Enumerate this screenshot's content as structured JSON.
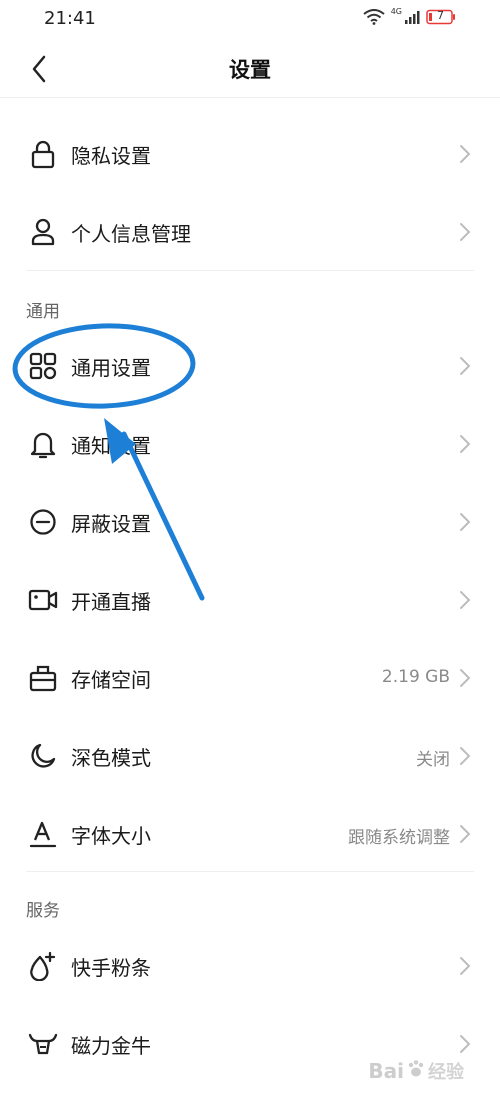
{
  "status": {
    "time": "21:41",
    "network": "4G",
    "battery": "7"
  },
  "nav": {
    "title": "设置"
  },
  "rows_top": [
    {
      "label": "隐私设置",
      "icon": "lock-icon"
    },
    {
      "label": "个人信息管理",
      "icon": "person-icon"
    }
  ],
  "section_general": {
    "title": "通用"
  },
  "rows_general": [
    {
      "label": "通用设置",
      "icon": "grid-icon",
      "value": ""
    },
    {
      "label": "通知设置",
      "icon": "bell-icon",
      "value": ""
    },
    {
      "label": "屏蔽设置",
      "icon": "block-icon",
      "value": ""
    },
    {
      "label": "开通直播",
      "icon": "video-camera-icon",
      "value": ""
    },
    {
      "label": "存储空间",
      "icon": "storage-icon",
      "value": "2.19 GB"
    },
    {
      "label": "深色模式",
      "icon": "moon-icon",
      "value": "关闭"
    },
    {
      "label": "字体大小",
      "icon": "font-size-icon",
      "value": "跟随系统调整"
    }
  ],
  "section_service": {
    "title": "服务"
  },
  "rows_service": [
    {
      "label": "快手粉条",
      "icon": "fire-plus-icon",
      "value": ""
    },
    {
      "label": "磁力金牛",
      "icon": "bull-icon",
      "value": ""
    }
  ],
  "watermark": {
    "brand": "Bai",
    "sub": "经验"
  },
  "colors": {
    "annotation": "#1e7fd6",
    "chevron": "#bdbdbd",
    "text": "#1a1a1a",
    "muted": "#8a8a8a"
  }
}
